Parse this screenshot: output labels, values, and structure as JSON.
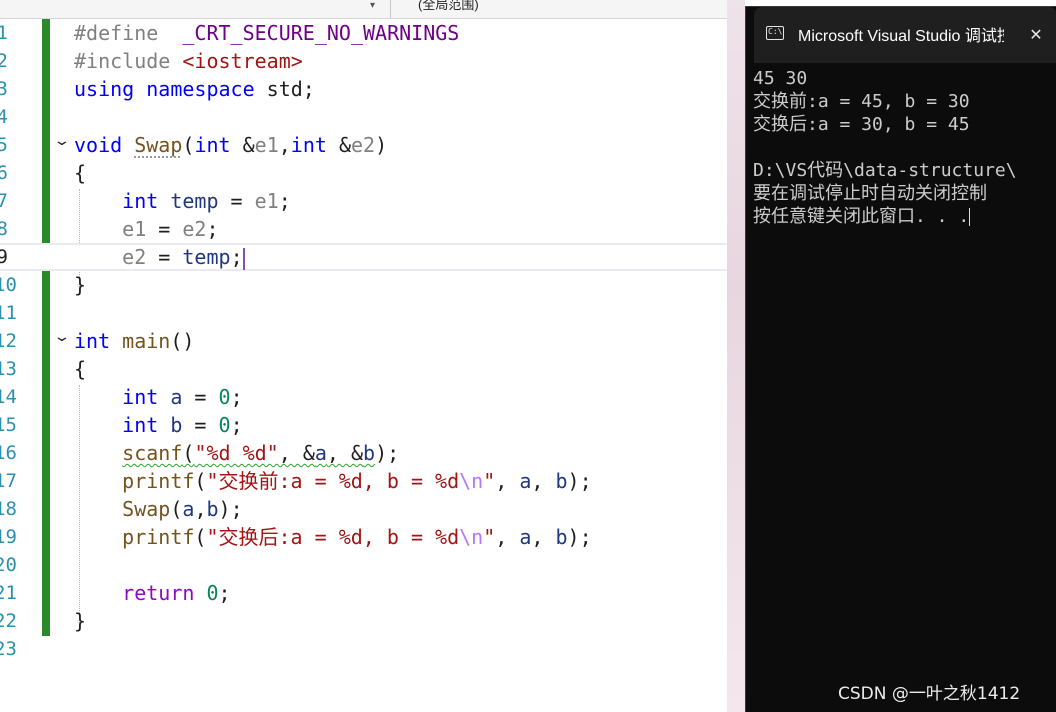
{
  "toolbar": {
    "scope_label": "(全局范围)",
    "dropdown_arrow": "▾"
  },
  "editor": {
    "current_line": "9",
    "lines": [
      {
        "n": "1",
        "parts": [
          {
            "t": "#define",
            "c": "pp"
          },
          {
            "t": "  ",
            "c": ""
          },
          {
            "t": "_CRT_SECURE_NO_WARNINGS",
            "c": "mac"
          }
        ]
      },
      {
        "n": "2",
        "parts": [
          {
            "t": "#include",
            "c": "pp"
          },
          {
            "t": " ",
            "c": ""
          },
          {
            "t": "<iostream>",
            "c": "str"
          }
        ]
      },
      {
        "n": "3",
        "parts": [
          {
            "t": "using",
            "c": "kw"
          },
          {
            "t": " ",
            "c": ""
          },
          {
            "t": "namespace",
            "c": "kw"
          },
          {
            "t": " std;",
            "c": ""
          }
        ]
      },
      {
        "n": "4",
        "parts": []
      },
      {
        "n": "5",
        "parts": [
          {
            "t": "void",
            "c": "kw"
          },
          {
            "t": " ",
            "c": ""
          },
          {
            "t": "Swap",
            "c": "fn dots"
          },
          {
            "t": "(",
            "c": ""
          },
          {
            "t": "int",
            "c": "kw"
          },
          {
            "t": " &",
            "c": ""
          },
          {
            "t": "e1",
            "c": "par"
          },
          {
            "t": ",",
            "c": ""
          },
          {
            "t": "int",
            "c": "kw"
          },
          {
            "t": " &",
            "c": ""
          },
          {
            "t": "e2",
            "c": "par"
          },
          {
            "t": ")",
            "c": ""
          }
        ]
      },
      {
        "n": "6",
        "parts": [
          {
            "t": "{",
            "c": ""
          }
        ]
      },
      {
        "n": "7",
        "parts": [
          {
            "t": "    ",
            "c": ""
          },
          {
            "t": "int",
            "c": "kw"
          },
          {
            "t": " ",
            "c": ""
          },
          {
            "t": "temp",
            "c": "var"
          },
          {
            "t": " = ",
            "c": ""
          },
          {
            "t": "e1",
            "c": "par"
          },
          {
            "t": ";",
            "c": ""
          }
        ]
      },
      {
        "n": "8",
        "parts": [
          {
            "t": "    ",
            "c": ""
          },
          {
            "t": "e1",
            "c": "par"
          },
          {
            "t": " = ",
            "c": ""
          },
          {
            "t": "e2",
            "c": "par"
          },
          {
            "t": ";",
            "c": ""
          }
        ]
      },
      {
        "n": "9",
        "parts": [
          {
            "t": "    ",
            "c": ""
          },
          {
            "t": "e2",
            "c": "par"
          },
          {
            "t": " = ",
            "c": ""
          },
          {
            "t": "temp",
            "c": "var"
          },
          {
            "t": ";",
            "c": ""
          }
        ]
      },
      {
        "n": "10",
        "parts": [
          {
            "t": "}",
            "c": ""
          }
        ]
      },
      {
        "n": "11",
        "parts": []
      },
      {
        "n": "12",
        "parts": [
          {
            "t": "int",
            "c": "kw"
          },
          {
            "t": " ",
            "c": ""
          },
          {
            "t": "main",
            "c": "fn"
          },
          {
            "t": "()",
            "c": ""
          }
        ]
      },
      {
        "n": "13",
        "parts": [
          {
            "t": "{",
            "c": ""
          }
        ]
      },
      {
        "n": "14",
        "parts": [
          {
            "t": "    ",
            "c": ""
          },
          {
            "t": "int",
            "c": "kw"
          },
          {
            "t": " ",
            "c": ""
          },
          {
            "t": "a",
            "c": "var"
          },
          {
            "t": " = ",
            "c": ""
          },
          {
            "t": "0",
            "c": "num"
          },
          {
            "t": ";",
            "c": ""
          }
        ]
      },
      {
        "n": "15",
        "parts": [
          {
            "t": "    ",
            "c": ""
          },
          {
            "t": "int",
            "c": "kw"
          },
          {
            "t": " ",
            "c": ""
          },
          {
            "t": "b",
            "c": "var"
          },
          {
            "t": " = ",
            "c": ""
          },
          {
            "t": "0",
            "c": "num"
          },
          {
            "t": ";",
            "c": ""
          }
        ]
      },
      {
        "n": "16",
        "parts": [
          {
            "t": "    ",
            "c": ""
          },
          {
            "t": "scanf",
            "c": "fn squig"
          },
          {
            "t": "(",
            "c": "squig"
          },
          {
            "t": "\"%d %d\"",
            "c": "str squig"
          },
          {
            "t": ", &",
            "c": "squig"
          },
          {
            "t": "a",
            "c": "var squig"
          },
          {
            "t": ", &",
            "c": "squig"
          },
          {
            "t": "b",
            "c": "var squig"
          },
          {
            "t": ");",
            "c": ""
          }
        ]
      },
      {
        "n": "17",
        "parts": [
          {
            "t": "    ",
            "c": ""
          },
          {
            "t": "printf",
            "c": "fn"
          },
          {
            "t": "(",
            "c": ""
          },
          {
            "t": "\"交换前:a = %d, b = %d",
            "c": "str"
          },
          {
            "t": "\\n",
            "c": "esc"
          },
          {
            "t": "\"",
            "c": "str"
          },
          {
            "t": ", ",
            "c": ""
          },
          {
            "t": "a",
            "c": "var"
          },
          {
            "t": ", ",
            "c": ""
          },
          {
            "t": "b",
            "c": "var"
          },
          {
            "t": ");",
            "c": ""
          }
        ]
      },
      {
        "n": "18",
        "parts": [
          {
            "t": "    ",
            "c": ""
          },
          {
            "t": "Swap",
            "c": "fn"
          },
          {
            "t": "(",
            "c": ""
          },
          {
            "t": "a",
            "c": "var"
          },
          {
            "t": ",",
            "c": ""
          },
          {
            "t": "b",
            "c": "var"
          },
          {
            "t": ");",
            "c": ""
          }
        ]
      },
      {
        "n": "19",
        "parts": [
          {
            "t": "    ",
            "c": ""
          },
          {
            "t": "printf",
            "c": "fn"
          },
          {
            "t": "(",
            "c": ""
          },
          {
            "t": "\"交换后:a = %d, b = %d",
            "c": "str"
          },
          {
            "t": "\\n",
            "c": "esc"
          },
          {
            "t": "\"",
            "c": "str"
          },
          {
            "t": ", ",
            "c": ""
          },
          {
            "t": "a",
            "c": "var"
          },
          {
            "t": ", ",
            "c": ""
          },
          {
            "t": "b",
            "c": "var"
          },
          {
            "t": ");",
            "c": ""
          }
        ]
      },
      {
        "n": "20",
        "parts": []
      },
      {
        "n": "21",
        "parts": [
          {
            "t": "    ",
            "c": ""
          },
          {
            "t": "return",
            "c": "ret"
          },
          {
            "t": " ",
            "c": ""
          },
          {
            "t": "0",
            "c": "num"
          },
          {
            "t": ";",
            "c": ""
          }
        ]
      },
      {
        "n": "22",
        "parts": [
          {
            "t": "}",
            "c": ""
          }
        ]
      },
      {
        "n": "23",
        "parts": []
      }
    ]
  },
  "console": {
    "title": "Microsoft Visual Studio 调试控制台",
    "close_glyph": "✕",
    "icon_glyph": "C:\\",
    "lines": [
      "45 30",
      "交换前:a = 45, b = 30",
      "交换后:a = 30, b = 45",
      "",
      "D:\\VS代码\\data-structure\\",
      "要在调试停止时自动关闭控制",
      "按任意键关闭此窗口. . ."
    ]
  },
  "watermark": "CSDN @一叶之秋1412",
  "colors": {
    "keyword": "#0000ff",
    "string": "#a31515",
    "preprocessor": "#808080",
    "macro": "#6f008a",
    "number": "#098658",
    "function": "#74531f",
    "variable": "#1f377f",
    "change_bar": "#2c8a2c",
    "console_bg": "#0c0c0c",
    "console_text": "#cccccc"
  }
}
